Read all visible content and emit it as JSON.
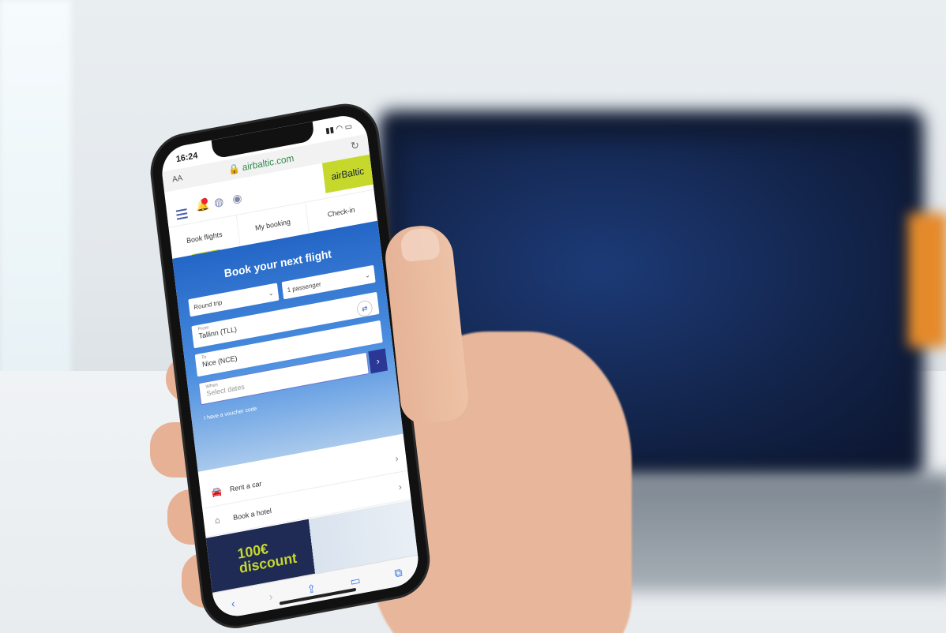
{
  "status": {
    "time": "16:24"
  },
  "browser": {
    "text_size_label": "AA",
    "url": "airbaltic.com"
  },
  "header": {
    "logo": "airBaltic"
  },
  "tabs": [
    {
      "label": "Book flights"
    },
    {
      "label": "My booking"
    },
    {
      "label": "Check-in"
    }
  ],
  "booking": {
    "title": "Book your next flight",
    "trip_type": "Round trip",
    "passengers": "1 passenger",
    "from_label": "From",
    "from_value": "Tallinn (TLL)",
    "to_label": "To",
    "to_value": "Nice (NCE)",
    "when_label": "When",
    "when_placeholder": "Select dates",
    "voucher": "I have a voucher code"
  },
  "services": [
    {
      "label": "Rent a car"
    },
    {
      "label": "Book a hotel"
    }
  ],
  "promo": {
    "line1": "100€",
    "line2": "discount"
  },
  "colors": {
    "brand_green": "#c6d82c",
    "brand_blue": "#2466c6",
    "button_dark": "#2b3794"
  }
}
